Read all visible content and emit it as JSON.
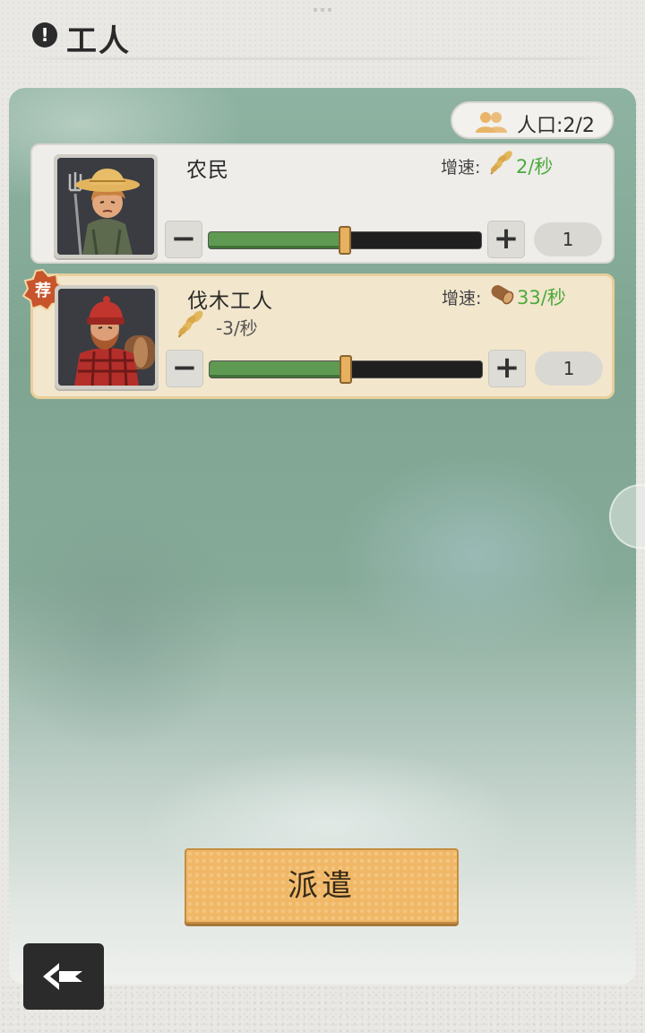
{
  "header": {
    "alert_icon": "alert-circle-icon",
    "title": "工人"
  },
  "population": {
    "icon": "people-icon",
    "label": "人口:2/2"
  },
  "workers": [
    {
      "name": "农民",
      "portrait": "farmer-portrait",
      "rate_label": "增速:",
      "rate_icon": "wheat-icon",
      "rate_value": "2/秒",
      "cost": null,
      "slider_fraction": 0.5,
      "count": "1",
      "recommended": false
    },
    {
      "name": "伐木工人",
      "portrait": "lumberjack-portrait",
      "rate_label": "增速:",
      "rate_icon": "log-icon",
      "rate_value": "33/秒",
      "cost_icon": "wheat-icon",
      "cost_value": "-3/秒",
      "slider_fraction": 0.5,
      "count": "1",
      "recommended": true,
      "recommended_badge": "荐"
    }
  ],
  "controls": {
    "minus_label": "−",
    "plus_label": "+"
  },
  "dispatch_button": "派遣",
  "back_button_icon": "back-arrow-icon",
  "colors": {
    "accent_orange": "#f0b866",
    "rate_green": "#4caa3e",
    "slider_green": "#5f9a52",
    "recommended_bg": "#f2e6cc"
  }
}
